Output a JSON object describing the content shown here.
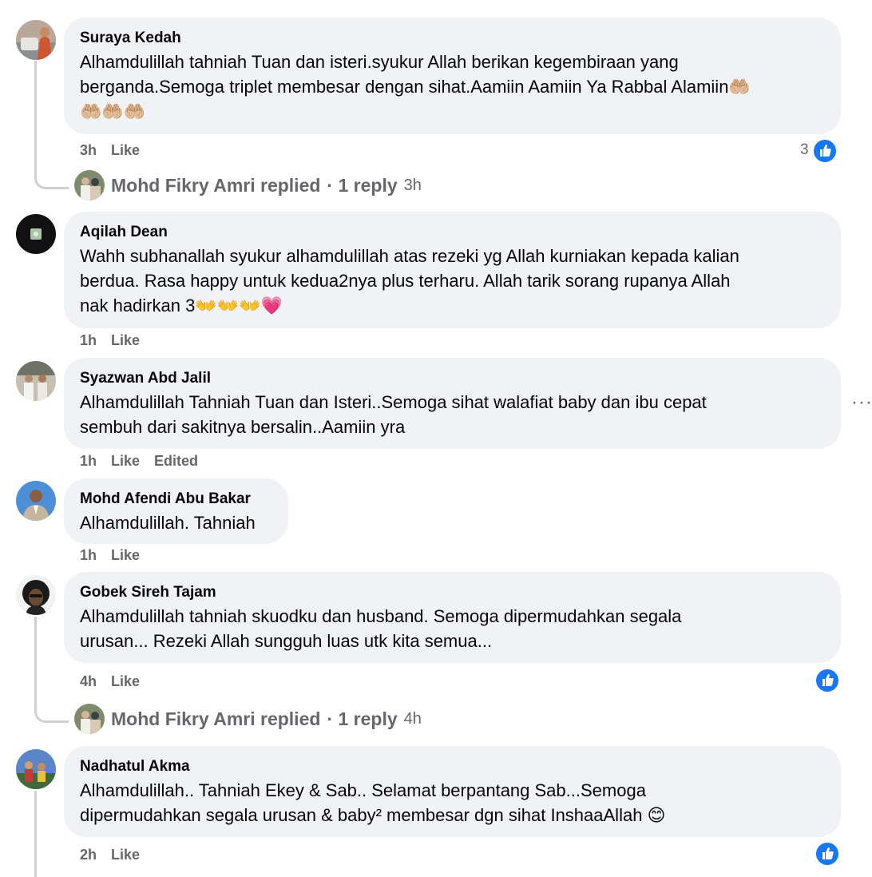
{
  "comments": [
    {
      "author": "Suraya Kedah",
      "text": "Alhamdulillah tahniah Tuan dan isteri.syukur Allah berikan kegembiraan yang\nberganda.Semoga triplet membesar dengan sihat.Aamiin Aamiin Ya Rabbal Alamiin🤲🏼\n🤲🏼🤲🏼🤲🏼",
      "time": "3h",
      "like_label": "Like",
      "reaction_count": "3",
      "reply": {
        "name": "Mohd Fikry Amri replied",
        "count": "· 1 reply",
        "time": "3h"
      }
    },
    {
      "author": "Aqilah Dean",
      "text": "Wahh subhanallah syukur alhamdulillah atas rezeki yg Allah kurniakan kepada kalian\nberdua. Rasa happy untuk kedua2nya plus terharu. Allah tarik sorang rupanya Allah\nnak hadirkan 3👐👐👐💗",
      "time": "1h",
      "like_label": "Like"
    },
    {
      "author": "Syazwan Abd Jalil",
      "text": "Alhamdulillah Tahniah Tuan dan Isteri..Semoga sihat walafiat baby dan ibu cepat\nsembuh dari sakitnya bersalin..Aamiin yra",
      "time": "1h",
      "like_label": "Like",
      "edited_label": "Edited"
    },
    {
      "author": "Mohd Afendi Abu Bakar",
      "text": "Alhamdulillah. Tahniah",
      "time": "1h",
      "like_label": "Like"
    },
    {
      "author": "Gobek Sireh Tajam",
      "text": "Alhamdulillah tahniah skuodku dan husband. Semoga dipermudahkan segala\nurusan... Rezeki Allah sungguh luas utk kita semua...",
      "time": "4h",
      "like_label": "Like",
      "reply": {
        "name": "Mohd Fikry Amri replied",
        "count": "· 1 reply",
        "time": "4h"
      }
    },
    {
      "author": "Nadhatul Akma",
      "text": "Alhamdulillah.. Tahniah Ekey & Sab.. Selamat berpantang Sab...Semoga\ndipermudahkan segala urusan & baby² membesar dgn sihat InshaaAllah 😊",
      "time": "2h",
      "like_label": "Like"
    }
  ],
  "more_options": "···",
  "colors": {
    "bubble": "#f0f2f5",
    "meta": "#65676b",
    "like_blue": "#1877f2"
  },
  "icons": [
    "thumbs-up-icon",
    "more-options-icon"
  ]
}
